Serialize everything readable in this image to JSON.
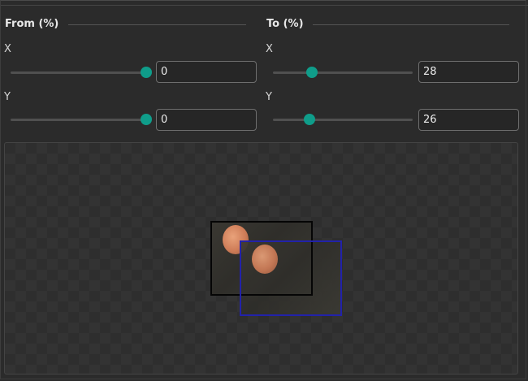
{
  "from": {
    "title": "From (%)",
    "x": {
      "label": "X",
      "value": "0",
      "slider_fraction": 1.0
    },
    "y": {
      "label": "Y",
      "value": "0",
      "slider_fraction": 1.0
    }
  },
  "to": {
    "title": "To (%)",
    "x": {
      "label": "X",
      "value": "28",
      "slider_fraction": 0.28
    },
    "y": {
      "label": "Y",
      "value": "26",
      "slider_fraction": 0.26
    }
  },
  "colors": {
    "accent": "#0f9d8a",
    "from_box": "#050505",
    "to_box": "#2222aa"
  }
}
